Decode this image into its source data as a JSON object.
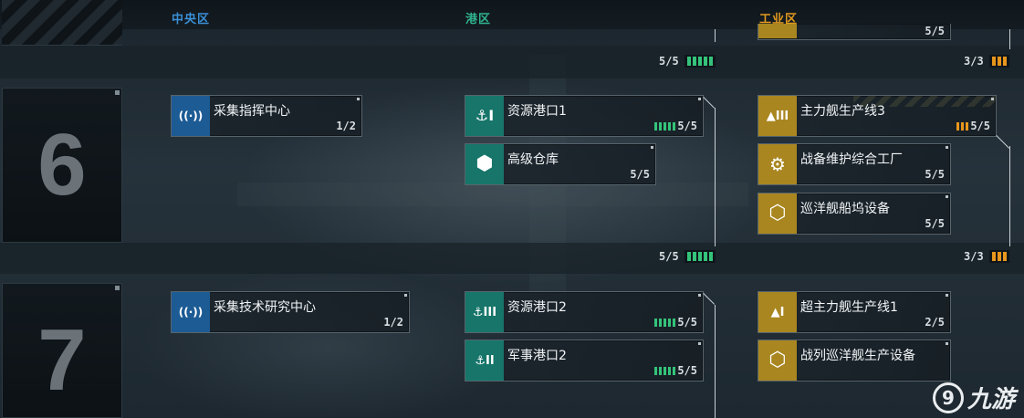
{
  "header": {
    "zones": [
      {
        "label": "中央区",
        "color": "#3a8fd6"
      },
      {
        "label": "港区",
        "color": "#2fb38f"
      },
      {
        "label": "工业区",
        "color": "#e29a1f"
      }
    ]
  },
  "tiers": [
    {
      "number": "6",
      "central": [
        {
          "name": "采集指挥中心",
          "count": "1/2",
          "icon": "signal-icon",
          "glyph": "((·))"
        }
      ],
      "port": [
        {
          "name": "资源港口1",
          "count": "5/5",
          "level_bars": 5,
          "icon": "anchor-icon",
          "glyph": "⚓I"
        },
        {
          "name": "高级仓库",
          "count": "5/5",
          "icon": "crates-icon",
          "glyph": "⬢"
        }
      ],
      "industrial": [
        {
          "name": "主力舰生产线3",
          "count": "5/5",
          "level_bars": 3,
          "icon": "shipyard-icon",
          "glyph": "▲III"
        },
        {
          "name": "战备维护综合工厂",
          "count": "5/5",
          "icon": "wrench-icon",
          "glyph": "⚙"
        },
        {
          "name": "巡洋舰船坞设备",
          "count": "5/5",
          "icon": "hex-dock-icon",
          "glyph": "⬡"
        }
      ],
      "progress": {
        "port": "5/5",
        "industrial": "3/3"
      }
    },
    {
      "number": "7",
      "central": [
        {
          "name": "采集技术研究中心",
          "count": "1/2",
          "icon": "signal-icon",
          "glyph": "((·))"
        }
      ],
      "port": [
        {
          "name": "资源港口2",
          "count": "5/5",
          "level_bars": 5,
          "icon": "anchor-icon",
          "glyph": "⚓III"
        },
        {
          "name": "军事港口2",
          "count": "5/5",
          "level_bars": 5,
          "icon": "anchor-missile-icon",
          "glyph": "⚓II"
        }
      ],
      "industrial": [
        {
          "name": "超主力舰生产线1",
          "count": "2/5",
          "icon": "shipyard-icon",
          "glyph": "▲I"
        },
        {
          "name": "战列巡洋舰生产设备",
          "count": "",
          "icon": "hex-ship-icon",
          "glyph": "⬡"
        }
      ]
    }
  ],
  "top_progress": {
    "port": "5/5",
    "industrial": "3/3",
    "industrial_top_count": "5/5"
  },
  "watermark": {
    "logo": "9",
    "text": "九游"
  },
  "colors": {
    "port_bar": "#34c47a",
    "industrial_bar": "#e8961c",
    "bar_dim": "#2b3a33"
  }
}
